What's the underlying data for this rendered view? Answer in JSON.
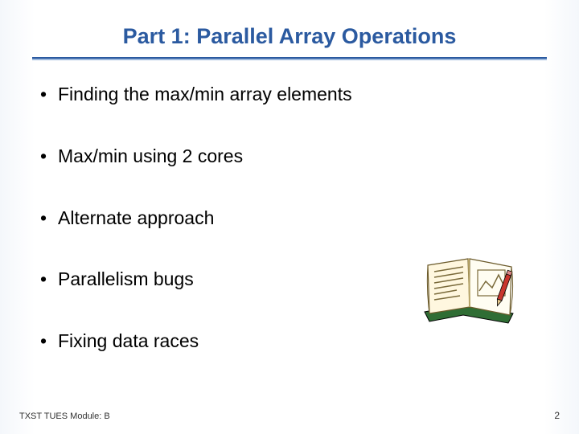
{
  "title": "Part 1: Parallel Array Operations",
  "bullets": [
    "Finding the max/min array elements",
    "Max/min using 2 cores",
    "Alternate approach",
    "Parallelism bugs",
    "Fixing data races"
  ],
  "footer_left": "TXST TUES Module: B",
  "page_number": "2",
  "clip_art_name": "open-book-icon"
}
